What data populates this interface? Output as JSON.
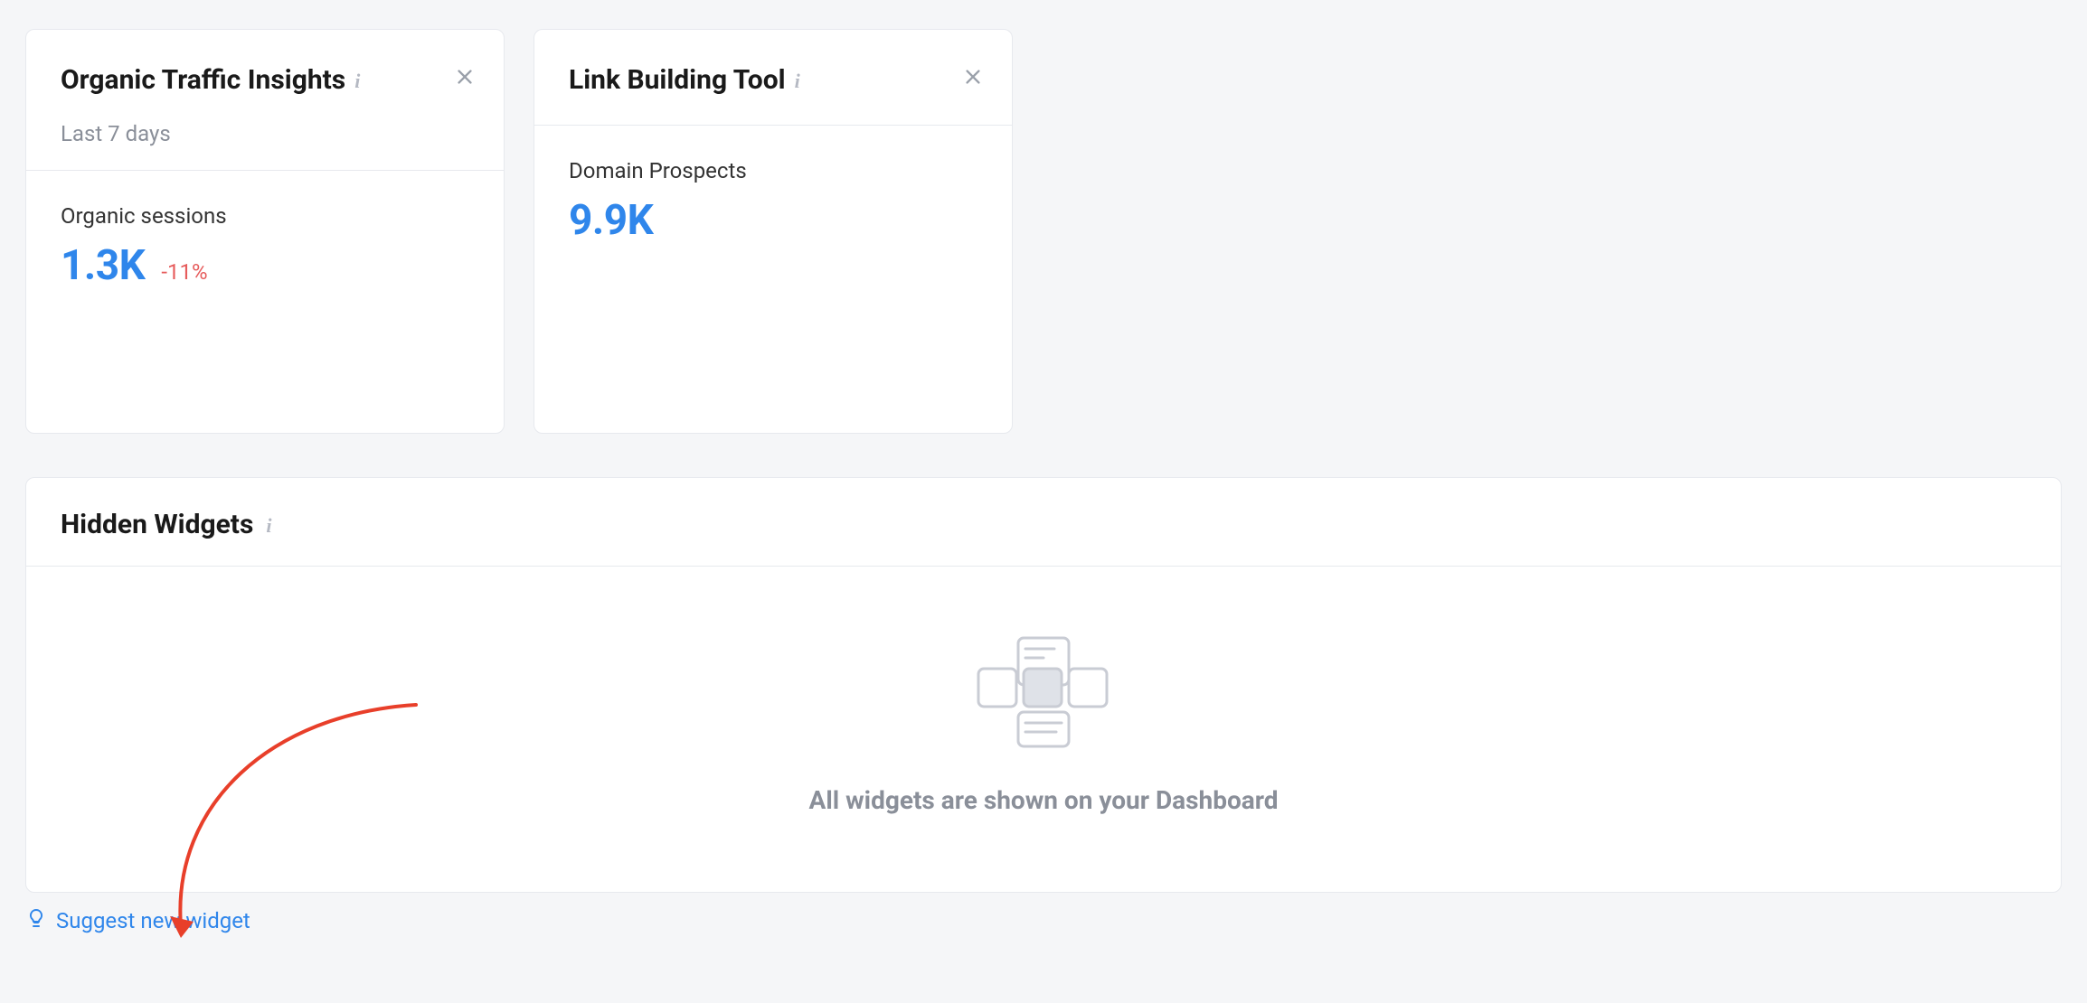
{
  "widgets": [
    {
      "title": "Organic Traffic Insights",
      "subheader": "Last 7 days",
      "metric_label": "Organic sessions",
      "metric_value": "1.3K",
      "metric_delta": "-11%"
    },
    {
      "title": "Link Building Tool",
      "metric_label": "Domain Prospects",
      "metric_value": "9.9K"
    }
  ],
  "hidden_section": {
    "title": "Hidden Widgets",
    "empty_message": "All widgets are shown on your Dashboard"
  },
  "suggest_link": "Suggest new widget"
}
